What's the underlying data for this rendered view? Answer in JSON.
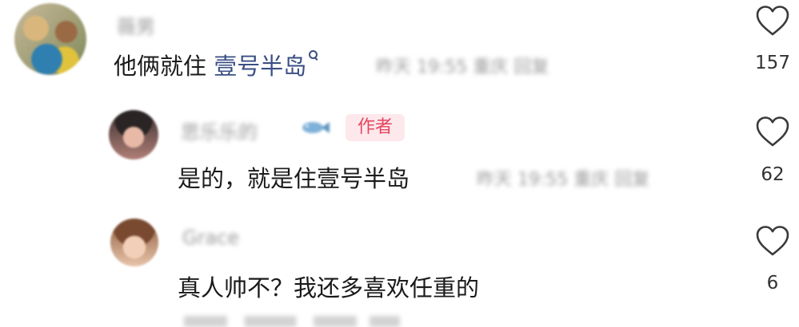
{
  "comments": [
    {
      "username": "薇男",
      "text": "他俩就住 ",
      "link_text": "壹号半岛",
      "meta": "昨天 19:55 重庆 回复",
      "likes": "157",
      "avatar_icon": "user-avatar-icon"
    },
    {
      "username": "思乐乐的",
      "badge": "作者",
      "text": "是的，就是住壹号半岛",
      "meta": "昨天 19:55 重庆 回复",
      "likes": "62",
      "avatar_icon": "user-avatar-icon"
    },
    {
      "username": "Grace",
      "text": "真人帅不？我还多喜欢任重的",
      "likes": "6",
      "avatar_icon": "user-avatar-icon"
    }
  ],
  "colors": {
    "link": "#3a4e84",
    "badge_text": "#e5465e",
    "badge_bg": "#fde8ec",
    "heart_stroke": "#3a3a3a"
  },
  "icons": {
    "like": "heart-outline-icon",
    "search": "search-icon",
    "decoration": "fish-emoji-icon"
  }
}
